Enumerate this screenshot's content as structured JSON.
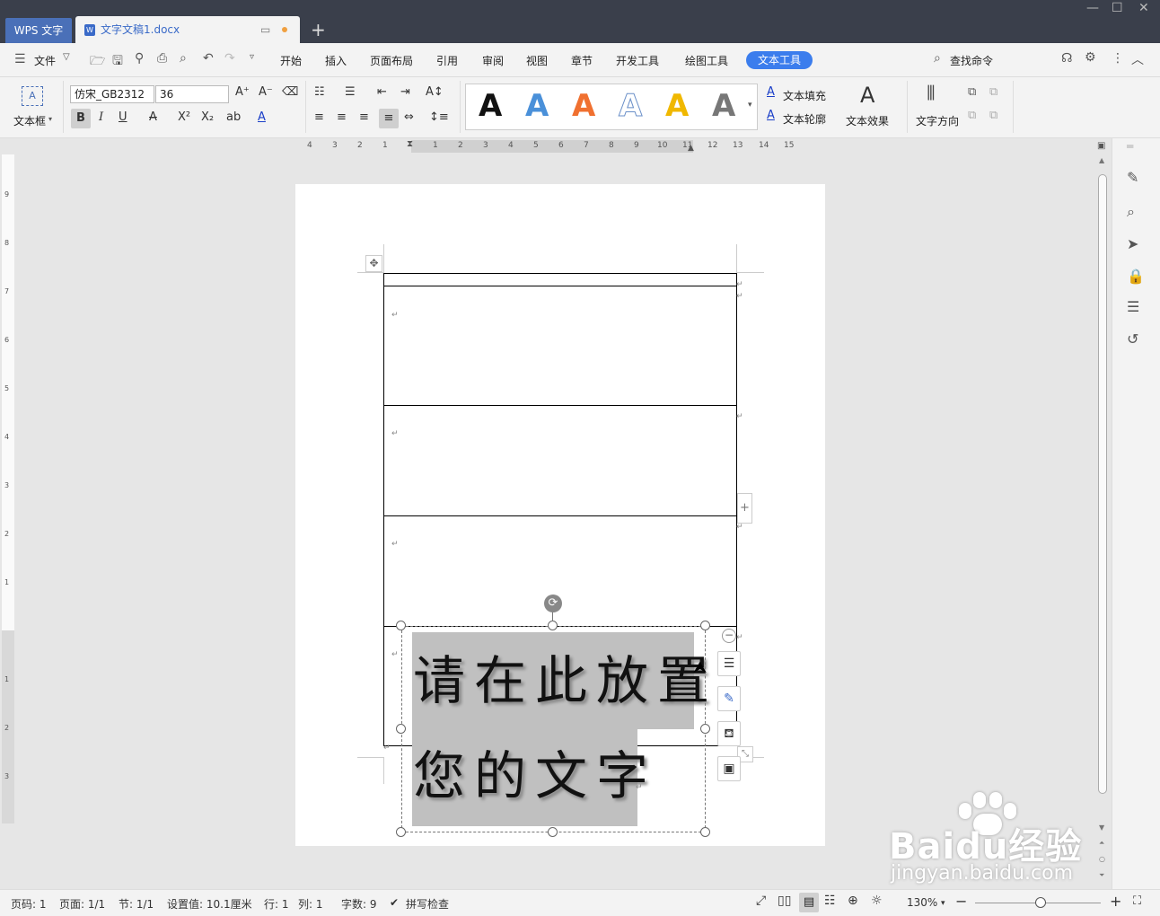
{
  "titlebar": {
    "app_tab": "WPS 文字",
    "doc_tab": "文字文稿1.docx",
    "new_tab": "+",
    "controls": [
      "—",
      "☐",
      "✕"
    ]
  },
  "menubar": {
    "file_label": "文件",
    "tabs": [
      "开始",
      "插入",
      "页面布局",
      "引用",
      "审阅",
      "视图",
      "章节",
      "开发工具",
      "绘图工具",
      "文本工具"
    ],
    "active_tab": "文本工具",
    "search_label": "查找命令"
  },
  "ribbon": {
    "textbox_label": "文本框",
    "font_name": "仿宋_GB2312",
    "font_size": "36",
    "text_fill_label": "文本填充",
    "text_outline_label": "文本轮廓",
    "text_effect_label": "文本效果",
    "text_direction_label": "文字方向",
    "style_letters": [
      "A",
      "A",
      "A",
      "A",
      "A",
      "A"
    ],
    "style_colors": [
      "#111111",
      "#4a90d9",
      "#f07030",
      "#6a8fc8",
      "#f0b800",
      "#777777"
    ]
  },
  "ruler": {
    "h_numbers": [
      "4",
      "3",
      "2",
      "1",
      "1",
      "2",
      "3",
      "4",
      "5",
      "6",
      "7",
      "8",
      "9",
      "10",
      "11",
      "12",
      "13",
      "14",
      "15"
    ],
    "v_numbers_top": [
      "9",
      "8",
      "7",
      "6",
      "5",
      "4",
      "3",
      "2",
      "1"
    ],
    "v_numbers_bottom": [
      "1",
      "2",
      "3"
    ]
  },
  "document": {
    "textbox_line1": "请在此放置",
    "textbox_line2": "您的文字",
    "para_mark": "↵"
  },
  "statusbar": {
    "page_code": "页码: 1",
    "page": "页面: 1/1",
    "section": "节: 1/1",
    "setting": "设置值: 10.1厘米",
    "row": "行: 1",
    "col": "列: 1",
    "word_count": "字数: 9",
    "spell_check": "拼写检查",
    "zoom": "130%"
  },
  "watermark": {
    "logo": "Baidu经验",
    "url": "jingyan.baidu.com"
  }
}
